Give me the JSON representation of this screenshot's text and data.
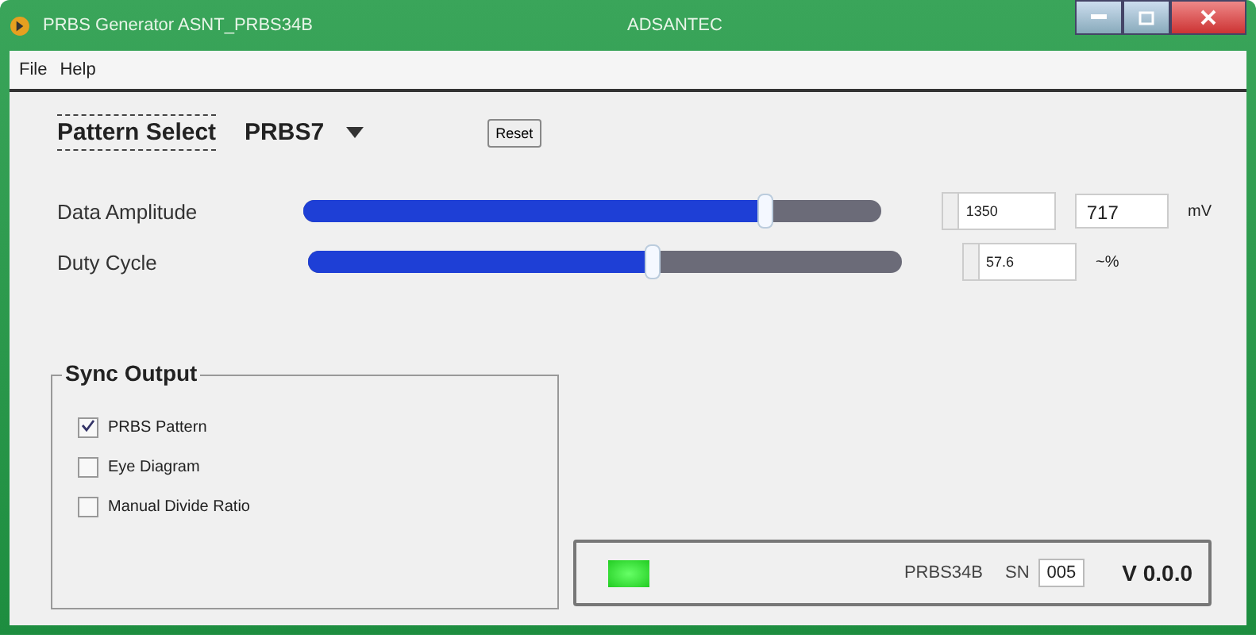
{
  "window": {
    "title": "PRBS Generator ASNT_PRBS34B",
    "company": "ADSANTEC"
  },
  "menu": [
    "File",
    "Help"
  ],
  "pattern_select": {
    "label": "Pattern Select",
    "value": "PRBS7"
  },
  "reset_button": "Reset",
  "sliders": [
    {
      "name": "Data Amplitude",
      "level": 0.8,
      "spin_value": "1350",
      "value": "717",
      "unit": "mV"
    },
    {
      "name": "Duty Cycle",
      "level": 0.58,
      "spin_value": "57.6",
      "unit": "~%"
    }
  ],
  "sync_output": {
    "title": "Sync Output",
    "options": [
      {
        "label": "PRBS Pattern",
        "checked": true
      },
      {
        "label": "Eye Diagram",
        "checked": false
      },
      {
        "label": "Manual Divide Ratio",
        "checked": false
      }
    ]
  },
  "status": {
    "led_on": true,
    "model": "PRBS34B",
    "sn_label": "SN",
    "sn": "005",
    "version": "V 0.0.0"
  }
}
